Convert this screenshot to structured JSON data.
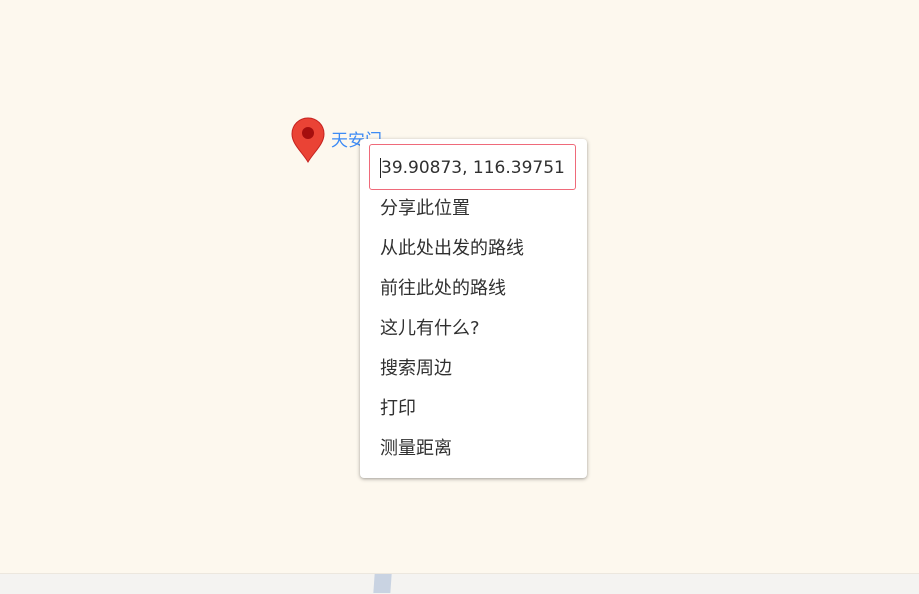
{
  "map": {
    "background_color": "#fdf8ee",
    "marker": {
      "icon": "map-pin-icon",
      "color": "#ea4335",
      "label": "天安门"
    }
  },
  "context_menu": {
    "coordinates": "39.90873, 116.39751",
    "items": [
      {
        "label": "分享此位置"
      },
      {
        "label": "从此处出发的路线"
      },
      {
        "label": "前往此处的路线"
      },
      {
        "label": "这儿有什么?"
      },
      {
        "label": "搜索周边"
      },
      {
        "label": "打印"
      },
      {
        "label": "测量距离"
      }
    ]
  }
}
